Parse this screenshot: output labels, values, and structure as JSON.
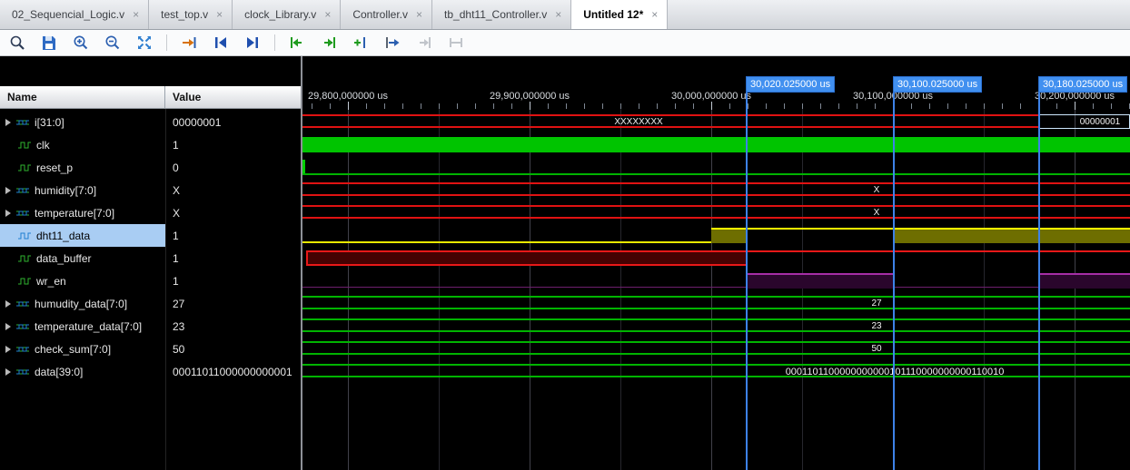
{
  "tabs": [
    {
      "label": "02_Sequencial_Logic.v"
    },
    {
      "label": "test_top.v"
    },
    {
      "label": "clock_Library.v"
    },
    {
      "label": "Controller.v"
    },
    {
      "label": "tb_dht11_Controller.v"
    },
    {
      "label": "Untitled 12*"
    }
  ],
  "toolbar": {
    "buttons": [
      "find",
      "save-waveform",
      "zoom-in",
      "zoom-out",
      "zoom-fit",
      "zoom-to-cursor",
      "go-to-start",
      "go-to-end",
      "previous-transition",
      "next-transition",
      "add-marker",
      "go-to-cursor",
      "previous-marker",
      "next-marker"
    ]
  },
  "panel": {
    "name_header": "Name",
    "value_header": "Value"
  },
  "signals": [
    {
      "name": "i[31:0]",
      "value": "00000001",
      "kind": "bus"
    },
    {
      "name": "clk",
      "value": "1",
      "kind": "scalar"
    },
    {
      "name": "reset_p",
      "value": "0",
      "kind": "scalar"
    },
    {
      "name": "humidity[7:0]",
      "value": "X",
      "kind": "bus"
    },
    {
      "name": "temperature[7:0]",
      "value": "X",
      "kind": "bus"
    },
    {
      "name": "dht11_data",
      "value": "1",
      "kind": "scalar",
      "selected": true
    },
    {
      "name": "data_buffer",
      "value": "1",
      "kind": "scalar"
    },
    {
      "name": "wr_en",
      "value": "1",
      "kind": "scalar"
    },
    {
      "name": "humudity_data[7:0]",
      "value": "27",
      "kind": "bus"
    },
    {
      "name": "temperature_data[7:0]",
      "value": "23",
      "kind": "bus"
    },
    {
      "name": "check_sum[7:0]",
      "value": "50",
      "kind": "bus"
    },
    {
      "name": "data[39:0]",
      "value": "00011011000000000001",
      "kind": "bus"
    }
  ],
  "ruler": {
    "unit": "us",
    "major_labels": [
      "29,800,000000 us",
      "29,900,000000 us",
      "30,000,000000 us",
      "30,100,000000 us",
      "30,200,000000 us"
    ],
    "cursors": [
      "30,020.025000 us",
      "30,100.025000 us",
      "30,180.025000 us"
    ]
  },
  "wave_labels": {
    "i_bus_old": "XXXXXXXX",
    "i_bus_new": "00000001",
    "humidity": "X",
    "temperature": "X",
    "humudity_data": "27",
    "temperature_data": "23",
    "check_sum": "50",
    "data_bus": "0001101100000000000101110000000000110010"
  },
  "colors": {
    "clk_green": "#00c400",
    "bus_red": "#e01212",
    "bus_green": "#00b400",
    "dht11_yellow": "#ffff00",
    "dht11_fill": "#6e6e00",
    "buffer_red_fill": "#450202",
    "wr_en_purple": "#a62ea6",
    "wr_en_fill": "#2a062c",
    "cursor_blue": "#3d82e8",
    "selection_blue": "#a9cdf3"
  }
}
